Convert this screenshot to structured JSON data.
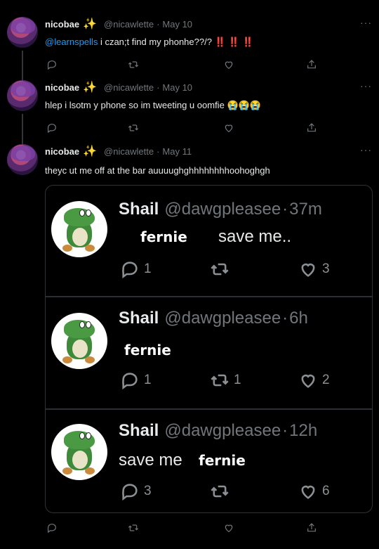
{
  "tweets": [
    {
      "name": "nicobae",
      "sparkle": "✨",
      "handle": "@nicawlette",
      "dot": "·",
      "date": "May 10",
      "mention": "@learnspells",
      "text": " i czan;t find my phonhe??/?",
      "bangs": "‼️ ‼️ ‼️"
    },
    {
      "name": "nicobae",
      "sparkle": "✨",
      "handle": "@nicawlette",
      "dot": "·",
      "date": "May 10",
      "text": "hlep i lsotm y phone so im tweeting u oomfie",
      "emoji": "😭😭😭"
    },
    {
      "name": "nicobae",
      "sparkle": "✨",
      "handle": "@nicawlette",
      "dot": "·",
      "date": "May 11",
      "text": "theyc ut me off at the bar auuuughghhhhhhhhoohoghgh"
    }
  ],
  "more_icon": "···",
  "embedded": [
    {
      "name": "Shail",
      "handle": "@dawgpleasee",
      "dot": "·",
      "time": "37m",
      "overlay": "fernie",
      "text": "save me..",
      "replies": "1",
      "retweets": "",
      "likes": "3"
    },
    {
      "name": "Shail",
      "handle": "@dawgpleasee",
      "dot": "·",
      "time": "6h",
      "overlay": "fernie",
      "text": "",
      "replies": "1",
      "retweets": "1",
      "likes": "2"
    },
    {
      "name": "Shail",
      "handle": "@dawgpleasee",
      "dot": "·",
      "time": "12h",
      "overlay": "fernie",
      "text": "save me",
      "replies": "3",
      "retweets": "",
      "likes": "6"
    }
  ],
  "icons": {
    "reply": "reply-icon",
    "retweet": "retweet-icon",
    "like": "heart-icon",
    "share": "share-icon"
  },
  "colors": {
    "background": "#000000",
    "link": "#1d9bf0",
    "muted": "#71767b"
  }
}
